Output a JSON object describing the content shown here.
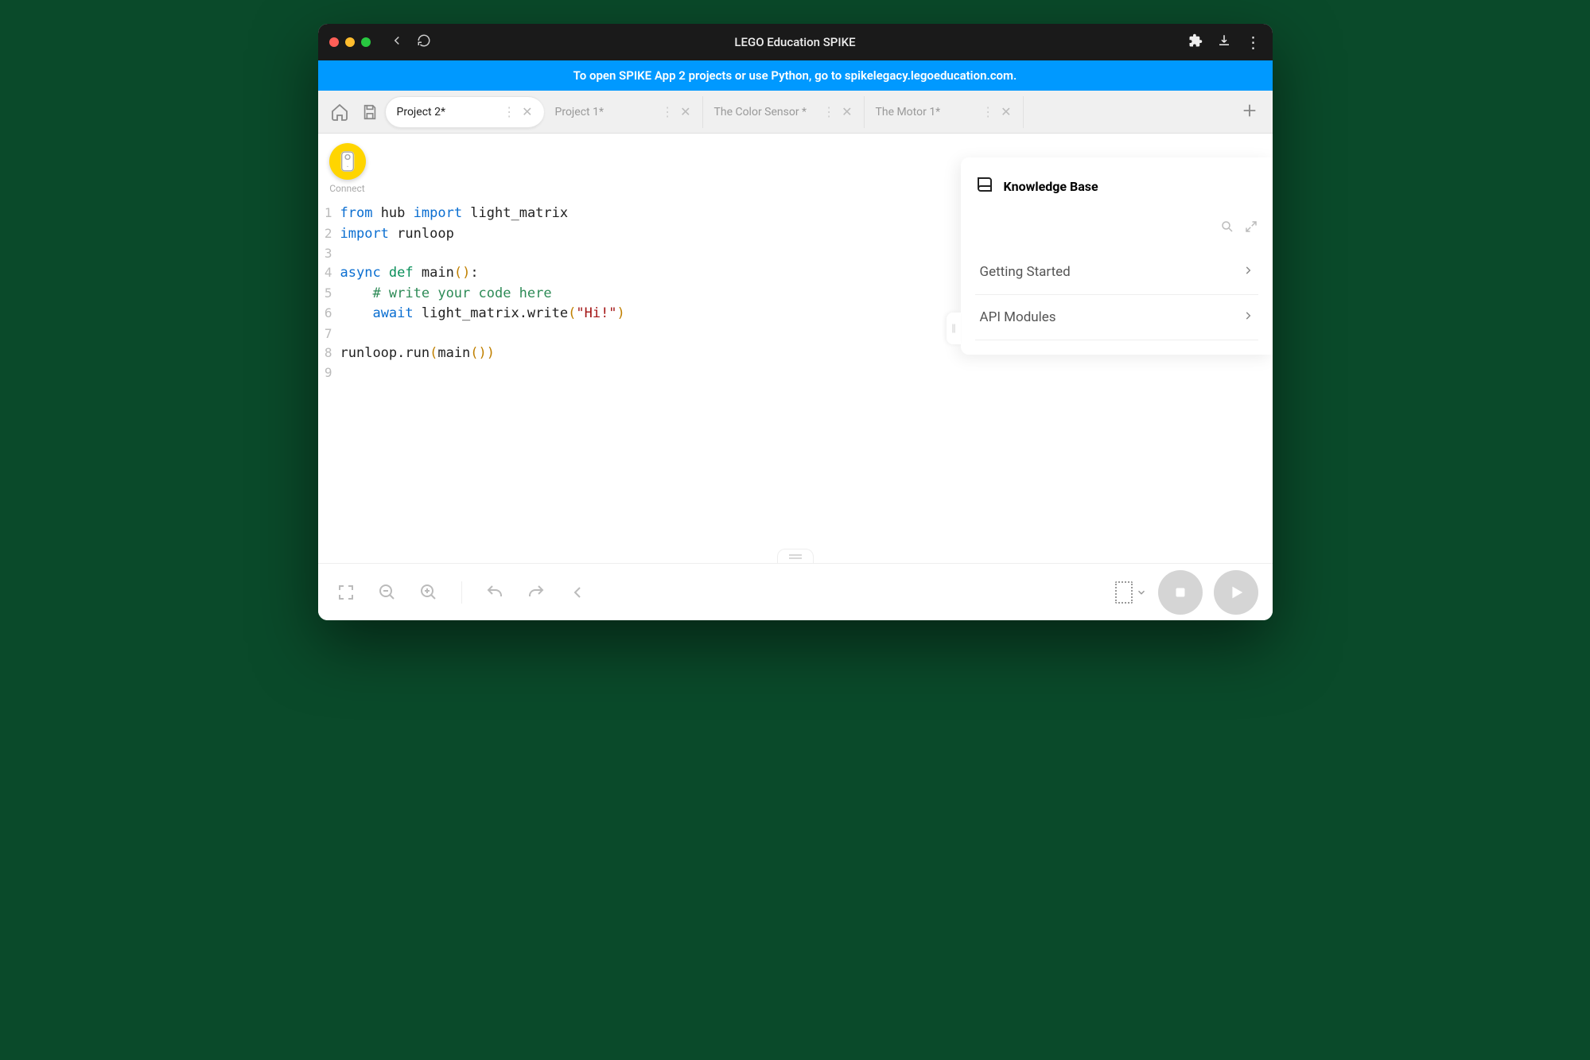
{
  "titlebar": {
    "title": "LEGO Education SPIKE"
  },
  "banner": {
    "text": "To open SPIKE App 2 projects or use Python, go to spikelegacy.legoeducation.com."
  },
  "tabs": [
    {
      "label": "Project 2*",
      "active": true
    },
    {
      "label": "Project 1*",
      "active": false
    },
    {
      "label": "The Color Sensor *",
      "active": false
    },
    {
      "label": "The Motor 1*",
      "active": false
    }
  ],
  "connect": {
    "label": "Connect"
  },
  "code": {
    "lines": [
      {
        "n": "1",
        "tokens": [
          [
            "kw",
            "from "
          ],
          [
            "id",
            "hub "
          ],
          [
            "kw",
            "import "
          ],
          [
            "id",
            "light_matrix"
          ]
        ]
      },
      {
        "n": "2",
        "tokens": [
          [
            "kw",
            "import "
          ],
          [
            "id",
            "runloop"
          ]
        ]
      },
      {
        "n": "3",
        "tokens": [
          [
            "",
            ""
          ]
        ]
      },
      {
        "n": "4",
        "tokens": [
          [
            "kw",
            "async "
          ],
          [
            "kw2",
            "def "
          ],
          [
            "id",
            "main"
          ],
          [
            "paren",
            "()"
          ],
          [
            "id",
            ":"
          ]
        ]
      },
      {
        "n": "5",
        "tokens": [
          [
            "",
            "    "
          ],
          [
            "comment",
            "# write your code here"
          ]
        ]
      },
      {
        "n": "6",
        "tokens": [
          [
            "",
            "    "
          ],
          [
            "kw",
            "await "
          ],
          [
            "id",
            "light_matrix.write"
          ],
          [
            "paren",
            "("
          ],
          [
            "str",
            "\"Hi!\""
          ],
          [
            "paren",
            ")"
          ]
        ]
      },
      {
        "n": "7",
        "tokens": [
          [
            "",
            ""
          ]
        ]
      },
      {
        "n": "8",
        "tokens": [
          [
            "id",
            "runloop.run"
          ],
          [
            "paren",
            "("
          ],
          [
            "id",
            "main"
          ],
          [
            "paren",
            "())"
          ]
        ]
      },
      {
        "n": "9",
        "tokens": [
          [
            "",
            ""
          ]
        ]
      }
    ]
  },
  "kb": {
    "title": "Knowledge Base",
    "items": [
      "Getting Started",
      "API Modules"
    ]
  }
}
